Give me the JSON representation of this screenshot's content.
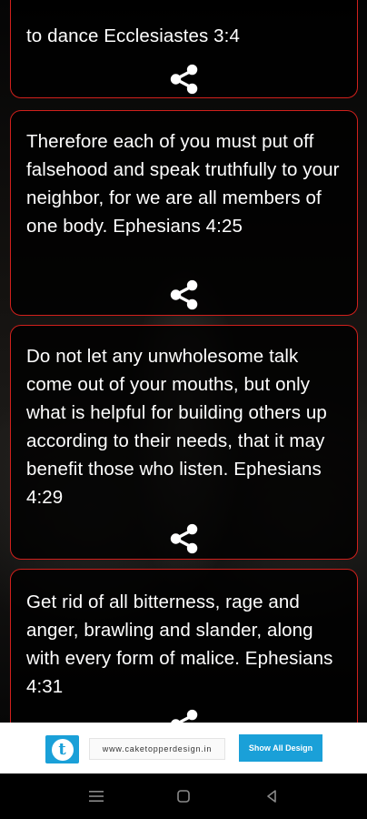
{
  "cards": [
    {
      "text": "to dance Ecclesiastes 3:4"
    },
    {
      "text": "Therefore each of you must put off falsehood and speak truthfully to your neighbor, for we are all members of one body. Ephesians 4:25"
    },
    {
      "text": "Do not let any unwholesome talk come out of your mouths, but only what is helpful for building others up according to their needs, that it may benefit those who listen. Ephesians 4:29"
    },
    {
      "text": "Get rid of all bitterness, rage and anger, brawling and slander, along with every form of malice. Ephesians 4:31"
    }
  ],
  "icons": {
    "share": "share-icon"
  },
  "colors": {
    "card_border": "#d0201c",
    "ad_accent": "#1aa0d8"
  },
  "ad": {
    "url": "www.caketopperdesign.in",
    "button_label": "Show All Design"
  },
  "navbar": {
    "icons": [
      "menu-icon",
      "home-square-icon",
      "back-triangle-icon"
    ]
  }
}
